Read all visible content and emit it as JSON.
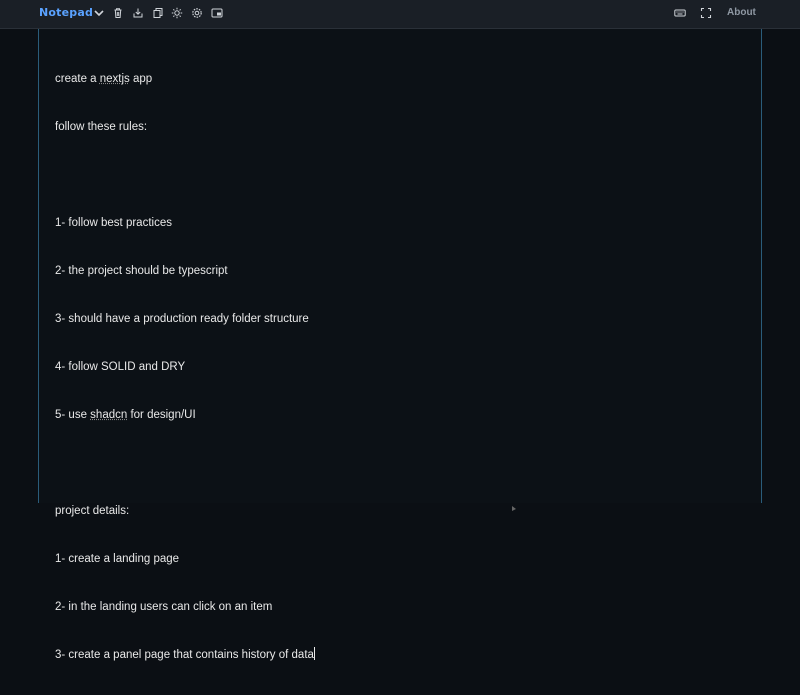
{
  "app": {
    "title": "Notepad",
    "about_label": "About"
  },
  "toolbar": {
    "icons": [
      "chevron-down-icon",
      "trash-icon",
      "save-icon",
      "copy-icon",
      "sun-icon",
      "gear-icon",
      "picture-in-picture-icon",
      "keyboard-icon",
      "fullscreen-icon"
    ]
  },
  "editor": {
    "lines": [
      [
        "create a ",
        "nextjs",
        " app"
      ],
      [
        "follow these rules:"
      ],
      [
        ""
      ],
      [
        "1- follow best practices"
      ],
      [
        "2- the project should be typescript"
      ],
      [
        "3- should have a production ready folder structure"
      ],
      [
        "4- follow SOLID and DRY"
      ],
      [
        "5- use ",
        "shadcn",
        " for design/UI"
      ],
      [
        ""
      ],
      [
        "project details:"
      ],
      [
        "1- create a landing page"
      ],
      [
        "2- in the landing users can click on an item"
      ],
      [
        "3- create a panel page that contains history of data"
      ]
    ]
  },
  "colors": {
    "accent": "#5aa2ff",
    "background": "#0b0f14",
    "toolbar": "#1a1f26"
  }
}
